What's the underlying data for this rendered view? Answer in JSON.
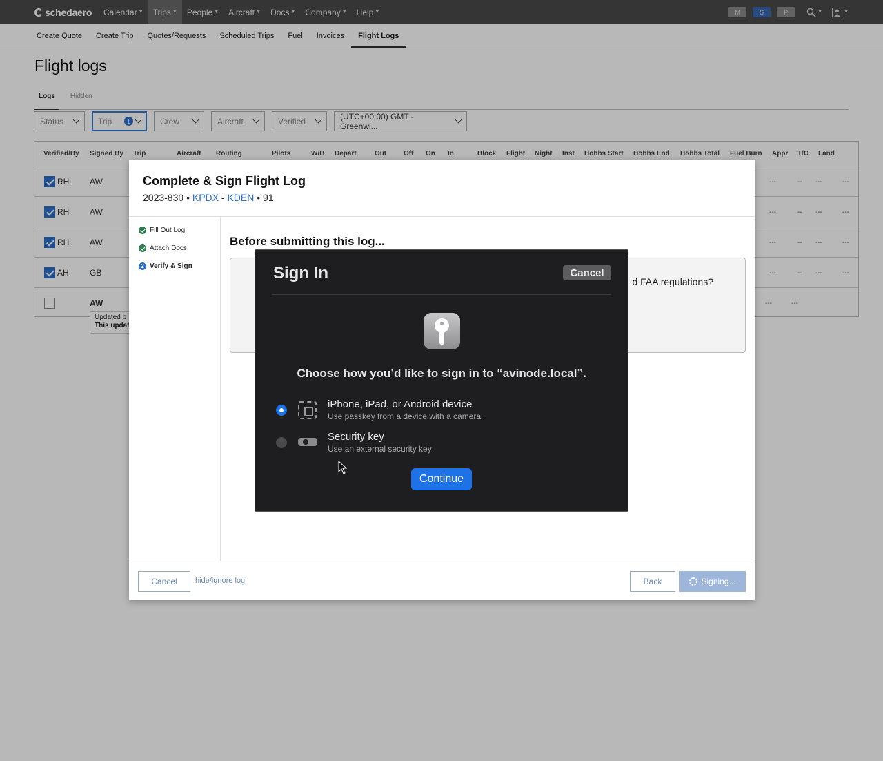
{
  "app": {
    "logo": "schedaero"
  },
  "topnav": {
    "items": [
      {
        "label": "Calendar"
      },
      {
        "label": "Trips"
      },
      {
        "label": "People"
      },
      {
        "label": "Aircraft"
      },
      {
        "label": "Docs"
      },
      {
        "label": "Company"
      },
      {
        "label": "Help"
      }
    ],
    "pills": [
      "M",
      "S",
      "P"
    ]
  },
  "subnav": {
    "items": [
      {
        "label": "Create Quote"
      },
      {
        "label": "Create Trip"
      },
      {
        "label": "Quotes/Requests"
      },
      {
        "label": "Scheduled Trips"
      },
      {
        "label": "Fuel"
      },
      {
        "label": "Invoices"
      },
      {
        "label": "Flight Logs"
      }
    ]
  },
  "page": {
    "title": "Flight logs",
    "tabs": [
      {
        "label": "Logs"
      },
      {
        "label": "Hidden"
      }
    ]
  },
  "filters": {
    "status": "Status",
    "trip": "Trip",
    "trip_count": "1",
    "crew": "Crew",
    "aircraft": "Aircraft",
    "verified": "Verified",
    "timezone": "(UTC+00:00) GMT - Greenwi..."
  },
  "table": {
    "headers": [
      "Verified/By",
      "Signed By",
      "Trip",
      "Aircraft",
      "Routing",
      "Pilots",
      "W/B",
      "Depart",
      "Out",
      "Off",
      "On",
      "In",
      "Block",
      "Flight",
      "Night",
      "Inst",
      "Hobbs Start",
      "Hobbs End",
      "Hobbs Total",
      "Fuel Burn",
      "Appr",
      "T/O",
      "Land"
    ],
    "rows": [
      {
        "verified_by": "RH",
        "signed_by": "AW",
        "appr": "---",
        "to": "--",
        "land1": "---",
        "land2": "---"
      },
      {
        "verified_by": "RH",
        "signed_by": "AW",
        "appr": "---",
        "to": "--",
        "land1": "---",
        "land2": "---"
      },
      {
        "verified_by": "RH",
        "signed_by": "AW",
        "appr": "---",
        "to": "--",
        "land1": "---",
        "land2": "---"
      },
      {
        "verified_by": "AH",
        "signed_by": "GB",
        "appr": "---",
        "to": "--",
        "land1": "---",
        "land2": "---"
      },
      {
        "verified_by": "",
        "signed_by": "AW",
        "appr": "---",
        "to": "---"
      }
    ],
    "tooltip": {
      "line1": "Updated b",
      "line2": "This updat"
    }
  },
  "modal": {
    "title": "Complete & Sign Flight Log",
    "trip_number": "2023-830",
    "bullet": "•",
    "origin": "KPDX",
    "dash": "-",
    "destination": "KDEN",
    "far_part": "91",
    "steps": [
      {
        "label": "Fill Out Log"
      },
      {
        "label": "Attach Docs"
      },
      {
        "label": "Verify & Sign",
        "number": "2"
      }
    ],
    "section_heading": "Before submitting this log...",
    "question_fragment": "d FAA regulations?",
    "cancel_label": "Cancel",
    "hide_label": "hide/ignore log",
    "back_label": "Back",
    "signing_label": "Signing..."
  },
  "passkey_dialog": {
    "title": "Sign In",
    "cancel_label": "Cancel",
    "heading": "Choose how you’d like to sign in to “avinode.local”.",
    "options": [
      {
        "title": "iPhone, iPad, or Android device",
        "subtitle": "Use passkey from a device with a camera",
        "selected": true,
        "icon": "qr-code-icon"
      },
      {
        "title": "Security key",
        "subtitle": "Use an external security key",
        "selected": false,
        "icon": "usb-key-icon"
      }
    ],
    "continue_label": "Continue"
  }
}
